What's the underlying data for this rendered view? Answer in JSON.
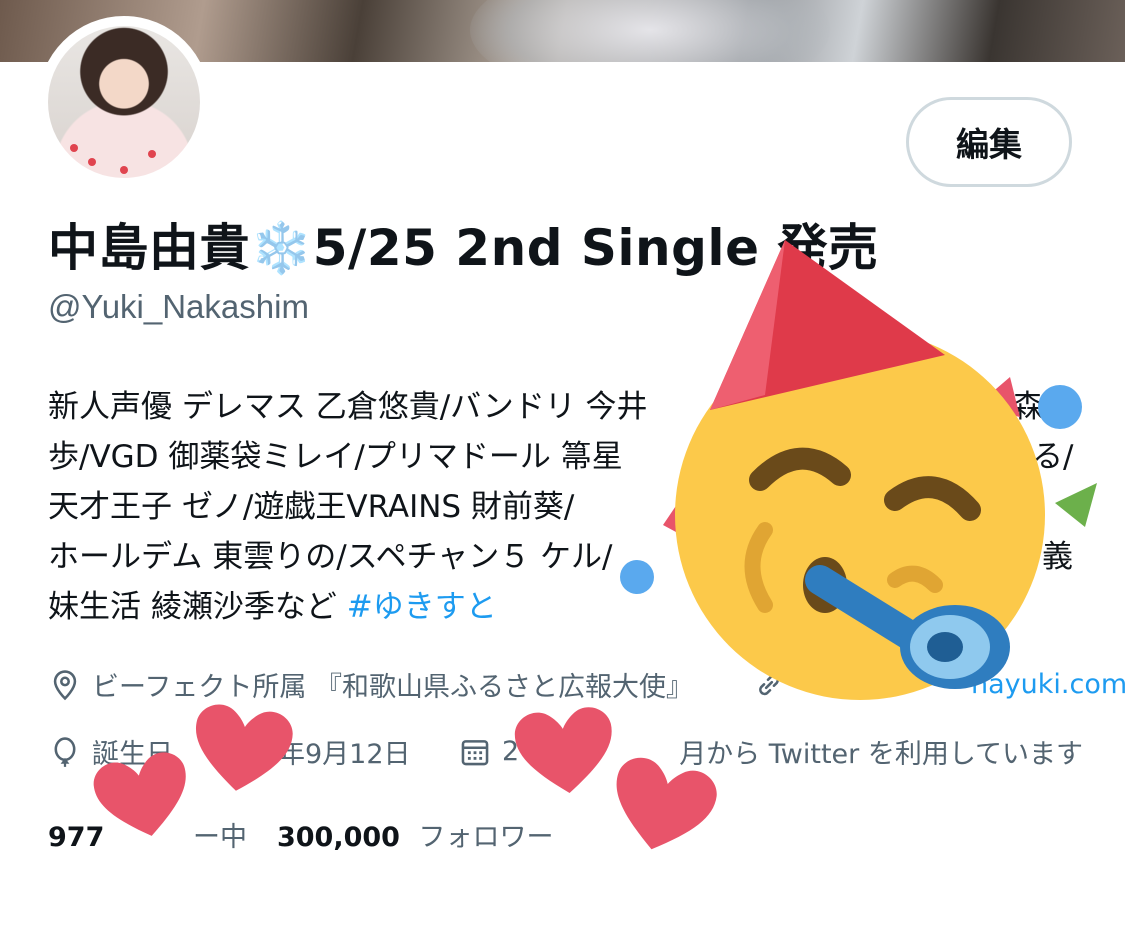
{
  "profile": {
    "edit_label": "編集",
    "display_name": "中島由貴",
    "display_name_emoji": "❄️",
    "display_name_suffix": "5/25 2nd Single 発売",
    "handle": "@Yuki_Nakashim"
  },
  "bio": {
    "line1": "新人声優 デレマス 乙倉悠貴/バンドリ 今井",
    "line1_end": "森",
    "line2": "歩/VGD 御薬袋ミレイ/プリマドール 箒星",
    "line2_end": "る/",
    "line3": "天才王子 ゼノ/遊戯王VRAINS 財前葵/",
    "line4": "ホールデム 東雲りの/スペチャン５ ケル/",
    "line4_end": "義",
    "line5": "妹生活 綾瀬沙季など",
    "hashtag": "#ゆきすと"
  },
  "meta": {
    "location": "ビーフェクト所属 『和歌山県ふるさと広報大使』",
    "link": "nayuki.com",
    "birthday": "誕生日",
    "birthday_date": "年9月12日",
    "joined_prefix": "2",
    "joined": "月から Twitter を利用しています"
  },
  "stats": {
    "following_count": "977",
    "following_label": "ー中",
    "followers_count": "300,000",
    "followers_label": "フォロワー"
  },
  "icons": {
    "location": "location-pin-icon",
    "link": "link-icon",
    "birthday": "balloon-icon",
    "joined": "calendar-icon"
  },
  "colors": {
    "accent": "#1d9bf0",
    "secondary_text": "#536471",
    "heart_sticker": "#e8546a",
    "party_face": "#fcc94a"
  }
}
